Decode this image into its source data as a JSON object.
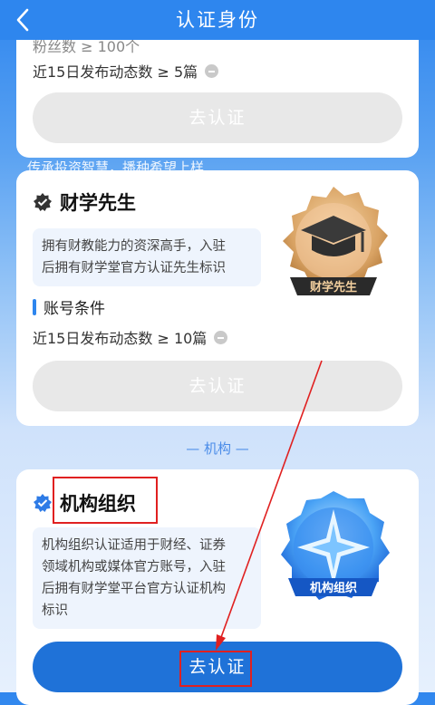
{
  "header": {
    "title": "认证身份"
  },
  "card1": {
    "partial_condition": "粉丝数 ≥ 100个",
    "condition": "近15日发布动态数 ≥ 5篇",
    "button": "去认证"
  },
  "faded_text": "传承投资智慧，播种希望上样",
  "card2": {
    "title": "财学先生",
    "description_line1": "拥有财教能力的资深高手，入驻",
    "description_line2": "后拥有财学堂官方认证先生标识",
    "section_label": "账号条件",
    "condition": "近15日发布动态数 ≥ 10篇",
    "button": "去认证",
    "badge_label": "财学先生"
  },
  "divider": "— 机构 —",
  "card3": {
    "title": "机构组织",
    "description_line1": "机构组织认证适用于财经、证券",
    "description_line2": "领域机构或媒体官方账号，入驻",
    "description_line3": "后拥有财学堂平台官方认证机构",
    "description_line4": "标识",
    "button": "去认证",
    "badge_label": "机构组织"
  },
  "colors": {
    "header": "#2e86ee",
    "primary_button": "#1f72d8",
    "disabled_button": "#e8e8e8",
    "annotation": "#e02020"
  }
}
